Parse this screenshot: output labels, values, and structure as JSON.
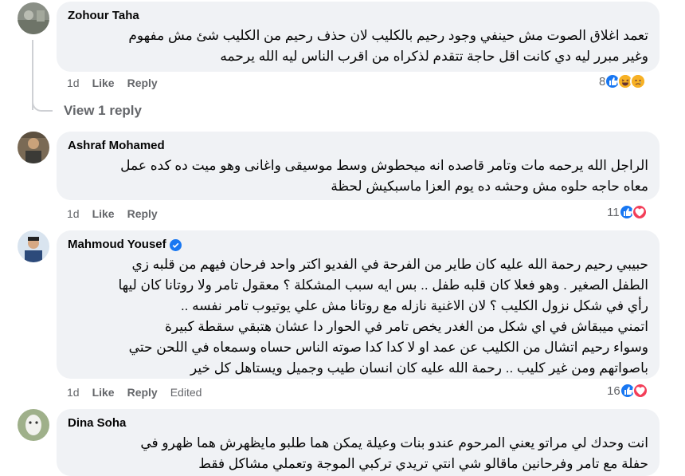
{
  "comments": [
    {
      "author": "Zohour Taha",
      "verified": false,
      "lines": [
        "تعمد اغلاق الصوت مش حينفي وجود رحيم بالكليب لان حذف رحيم من الكليب شئ مش مفهوم",
        "وغير مبرر ليه دي كانت اقل حاجة تتقدم لذكراه من اقرب الناس ليه الله يرحمه"
      ],
      "time": "1d",
      "like_label": "Like",
      "reply_label": "Reply",
      "edited_label": "",
      "reaction_count": "8",
      "reactions": [
        "like-reaction-icon",
        "haha-reaction-icon",
        "sad-reaction-icon"
      ]
    },
    {
      "author": "Ashraf Mohamed",
      "verified": false,
      "lines": [
        "الراجل الله يرحمه مات وتامر قاصده انه ميحطوش وسط موسيقى واغانى وهو ميت ده كده عمل",
        "معاه حاجه حلوه مش وحشه ده يوم العزا ماسبكيش لحظة"
      ],
      "time": "1d",
      "like_label": "Like",
      "reply_label": "Reply",
      "edited_label": "",
      "reaction_count": "11",
      "reactions": [
        "like-reaction-icon",
        "love-reaction-icon"
      ]
    },
    {
      "author": "Mahmoud Yousef",
      "verified": true,
      "lines": [
        "حبيبي رحيم رحمة الله عليه كان طاير من الفرحة في الفديو اكتر واحد فرحان فيهم من قلبه زي",
        "الطفل الصغير . وهو فعلا كان قلبه طفل .. بس ايه سبب المشكلة ؟ معقول تامر ولا روتانا كان ليها",
        "رأي في شكل نزول الكليب ؟ لان الاغنية نازله مع روتانا مش علي يوتيوب تامر نفسه ..",
        "اتمني ميبقاش في اي شكل من الغدر يخص تامر في الحوار دا عشان هتبقي سقطة كبيرة",
        "وسواء رحيم اتشال من الكليب عن عمد او لا كدا كدا صوته الناس حساه وسمعاه في اللحن حتي",
        "باصواتهم ومن غير كليب .. رحمة الله عليه كان انسان طيب وجميل ويستاهل كل خير"
      ],
      "time": "1d",
      "like_label": "Like",
      "reply_label": "Reply",
      "edited_label": "Edited",
      "reaction_count": "16",
      "reactions": [
        "like-reaction-icon",
        "love-reaction-icon"
      ]
    },
    {
      "author": "Dina Soha",
      "verified": false,
      "lines": [
        "انت وحدك لي مراتو يعني المرحوم عندو بنات وعيلة يمكن هما طلبو مايظهرش هما ظهرو في",
        "حفلة مع تامر وفرحانين ماقالو شي انتي تريدي تركبي الموجة وتعملي مشاكل فقط"
      ]
    }
  ],
  "view_replies_label": "View 1 reply",
  "colors": {
    "bubble_bg": "#f0f2f5",
    "meta_text": "#65676b",
    "like_blue": "#1877f2",
    "love_red": "#f33e58",
    "haha_yellow": "#f7b125"
  }
}
